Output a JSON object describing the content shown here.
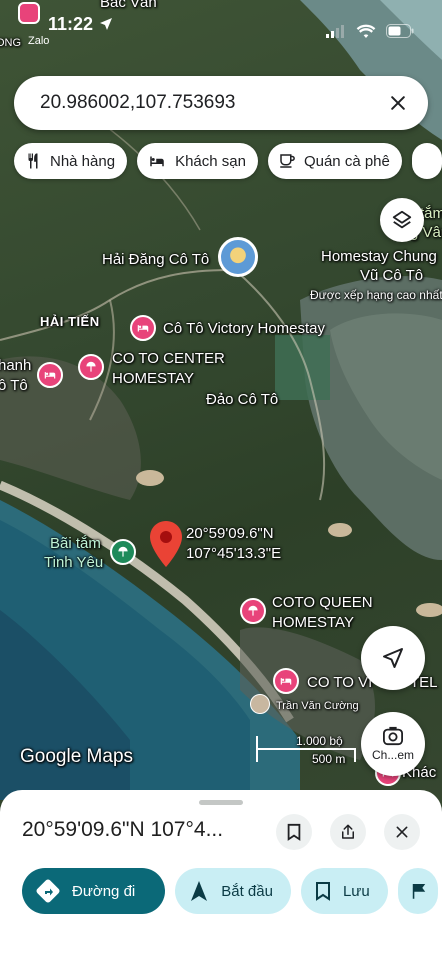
{
  "status": {
    "time": "11:22",
    "notif_label": "ONG",
    "app_label": "Zalo"
  },
  "search": {
    "query": "20.986002,107.753693"
  },
  "chips": [
    {
      "label": "Nhà hàng",
      "icon": "restaurant-icon"
    },
    {
      "label": "Khách sạn",
      "icon": "bed-icon"
    },
    {
      "label": "Quán cà phê",
      "icon": "coffee-icon"
    }
  ],
  "map": {
    "labels": {
      "top_place": "Bắc Vân",
      "lighthouse": "Hải Đăng Cô Tô",
      "hai_tien": "HẢI TIẾN",
      "victory": "Cô Tô Victory Homestay",
      "center_1": "CO TO CENTER",
      "center_2": "HOMESTAY",
      "left_1": "hanh",
      "left_2": "ô Tô",
      "island": "Đảo Cô Tô",
      "beach_1": "Bãi tắm",
      "beach_2": "Tinh Yêu",
      "coord_1": "20°59'09.6\"N",
      "coord_2": "107°45'13.3\"E",
      "queen_1": "COTO QUEEN",
      "queen_2": "HOMESTAY",
      "vip": "CO TO VI",
      "vip_tail": "TEL",
      "right_1": "Homestay Chung",
      "right_2": "Vũ Cô Tô",
      "right_3": "Được xếp hạng cao nhất",
      "right_tam": "tắm",
      "right_van": "g Vân",
      "photographer": "Trần Văn Cường",
      "khac": "Khác",
      "google": "Google Maps"
    },
    "scale": {
      "imperial": "1.000 bộ",
      "metric": "500 m"
    },
    "lens_label": "Ch...em"
  },
  "sheet": {
    "title": "20°59'09.6\"N 107°4...",
    "actions": [
      {
        "label": "Đường đi",
        "icon": "directions-icon"
      },
      {
        "label": "Bắt đầu",
        "icon": "navigation-icon"
      },
      {
        "label": "Lưu",
        "icon": "bookmark-icon"
      }
    ]
  },
  "colors": {
    "accent": "#0b6978",
    "poi_pink": "#e8437a",
    "poi_green": "#1e8a5a",
    "pin_red": "#ea4335"
  }
}
